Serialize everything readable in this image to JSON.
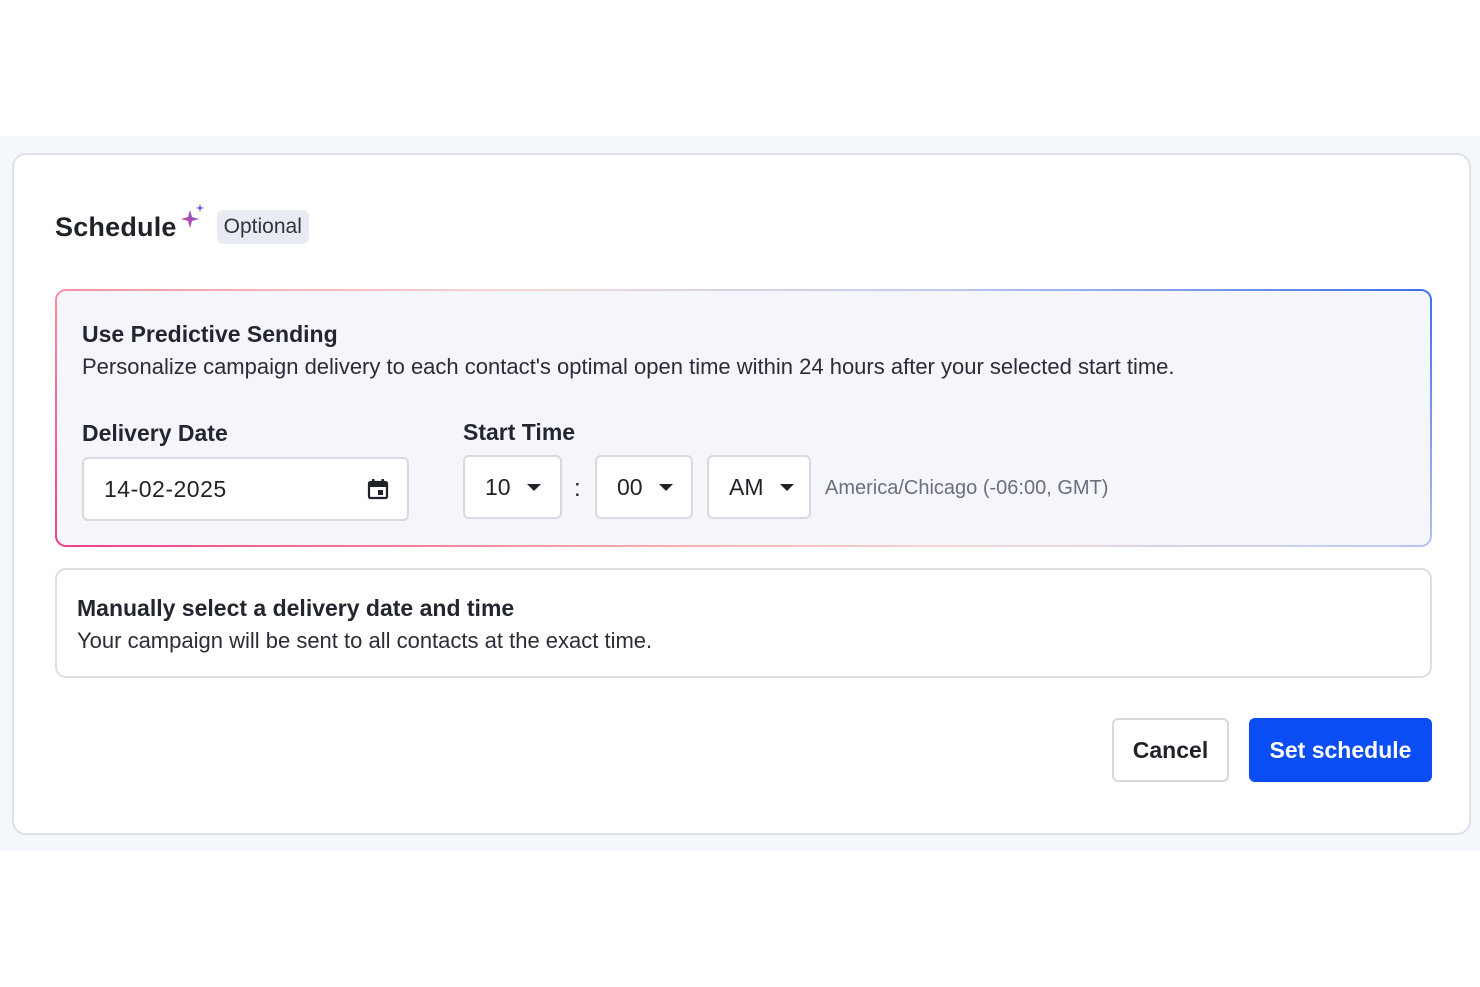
{
  "header": {
    "title": "Schedule",
    "badge": "Optional"
  },
  "predictive": {
    "title": "Use Predictive Sending",
    "description": "Personalize campaign delivery to each contact's optimal open time within 24 hours after your selected start time.",
    "delivery_date_label": "Delivery Date",
    "delivery_date_value": "14-02-2025",
    "start_time_label": "Start Time",
    "hour": "10",
    "separator": ":",
    "minute": "00",
    "meridiem": "AM",
    "timezone": "America/Chicago (-06:00, GMT)"
  },
  "manual": {
    "title": "Manually select a delivery date and time",
    "description": "Your campaign will be sent to all contacts at the exact time."
  },
  "actions": {
    "cancel_label": "Cancel",
    "submit_label": "Set schedule"
  },
  "icons": {
    "sparkle": "sparkle-icon",
    "calendar": "calendar-icon",
    "dropdown": "chevron-down-icon"
  },
  "colors": {
    "primary": "#0b4df5",
    "badge_bg": "#e9ebf3",
    "gradient_pink": "#ef3f87",
    "gradient_blue": "#3e6ee3"
  }
}
